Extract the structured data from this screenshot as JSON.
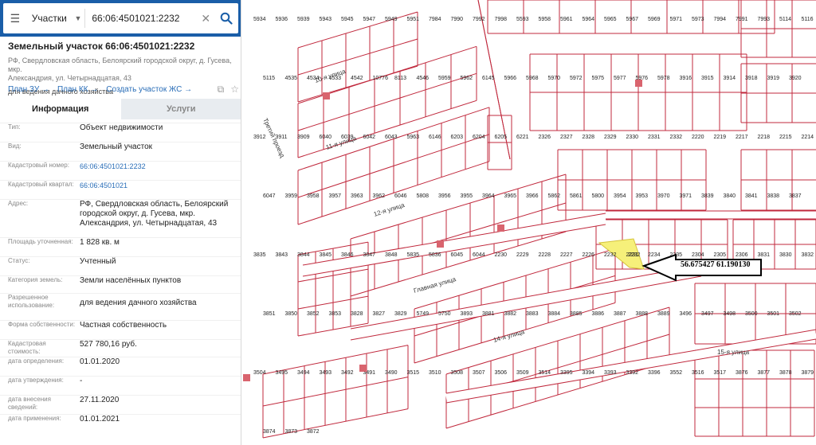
{
  "search": {
    "category": "Участки",
    "query": "66:06:4501021:2232"
  },
  "object": {
    "title": "Земельный участок 66:06:4501021:2232",
    "address_line1": "РФ, Свердловская область, Белоярский городской округ, д. Гусева, мкр.",
    "address_line2": "Александрия, ул. Четырнадцатая, 43",
    "purpose": "для ведения дачного хозяйства"
  },
  "links": [
    "План ЗУ",
    "План КК",
    "Создать участок ЖС"
  ],
  "tabs": [
    "Информация",
    "Услуги"
  ],
  "props": [
    {
      "label": "Тип:",
      "value": "Объект недвижимости"
    },
    {
      "label": "Вид:",
      "value": "Земельный участок"
    },
    {
      "label": "Кадастровый номер:",
      "value": "66:06:4501021:2232"
    },
    {
      "label": "Кадастровый квартал:",
      "value": "66:06:4501021"
    },
    {
      "label": "Адрес:",
      "value_lines": [
        "РФ, Свердловская область, Белоярский",
        "городской округ, д. Гусева, мкр.",
        "Александрия, ул. Четырнадцатая, 43"
      ]
    },
    {
      "label": "Площадь уточненная:",
      "value": "1 828 кв. м"
    },
    {
      "label": "Статус:",
      "value": "Учтенный"
    },
    {
      "label": "Категория земель:",
      "value": "Земли населённых пунктов"
    },
    {
      "label_lines": [
        "Разрешенное",
        "использование:"
      ],
      "value": "для ведения дачного хозяйства"
    },
    {
      "label": "Форма собственности:",
      "value": "Частная собственность"
    },
    {
      "label": "Кадастровая стоимость:",
      "value": "527 780,16 руб."
    },
    {
      "label": "дата определения:",
      "value": "01.01.2020"
    },
    {
      "label": "дата утверждения:",
      "value": "-"
    },
    {
      "label": "дата внесения сведений:",
      "value": "27.11.2020"
    },
    {
      "label": "дата применения:",
      "value": "01.01.2021"
    }
  ],
  "map": {
    "coordinate_label": "56.675427 61.190130",
    "highlight_parcel": "2232",
    "parcels": [
      "5934",
      "5936",
      "5939",
      "5943",
      "5945",
      "5947",
      "5949",
      "5951",
      "7984",
      "7990",
      "7992",
      "7998",
      "5593",
      "5958",
      "5961",
      "5964",
      "5965",
      "5967",
      "5969",
      "5971",
      "5973",
      "7994",
      "7991",
      "7993",
      "5114",
      "5116",
      "5115",
      "4535",
      "4534",
      "4533",
      "4542",
      "10776",
      "8113",
      "4546",
      "5959",
      "5962",
      "6145",
      "5966",
      "5968",
      "5970",
      "5972",
      "5975",
      "5977",
      "5976",
      "5978",
      "3916",
      "3915",
      "3914",
      "3918",
      "3919",
      "3920",
      "3921",
      "3912",
      "3911",
      "3909",
      "6040",
      "6039",
      "6042",
      "6043",
      "5963",
      "6146",
      "6203",
      "6204",
      "6205",
      "6221",
      "2326",
      "2327",
      "2328",
      "2329",
      "2330",
      "2331",
      "2332",
      "2220",
      "2219",
      "2217",
      "2218",
      "2215",
      "2214",
      "6047",
      "3959",
      "3958",
      "3957",
      "3963",
      "3962",
      "6046",
      "5808",
      "3956",
      "3955",
      "3964",
      "3965",
      "3966",
      "5862",
      "5861",
      "5800",
      "3954",
      "3953",
      "3970",
      "3971",
      "3839",
      "3840",
      "3841",
      "3838",
      "3837",
      "3836",
      "3835",
      "3843",
      "3844",
      "3845",
      "3846",
      "3847",
      "3848",
      "5835",
      "5836",
      "6045",
      "6044",
      "2230",
      "2229",
      "2228",
      "2227",
      "2226",
      "2232",
      "2231",
      "2234",
      "2235",
      "2304",
      "2305",
      "2306",
      "3831",
      "3830",
      "3832",
      "3851",
      "3850",
      "3852",
      "3853",
      "3828",
      "3827",
      "3829",
      "5749",
      "5750",
      "3893",
      "3881",
      "3882",
      "3883",
      "3884",
      "3885",
      "3886",
      "3887",
      "3888",
      "3889",
      "3496",
      "3497",
      "3498",
      "3500",
      "3501",
      "3502",
      "3503",
      "3504",
      "3495",
      "3494",
      "3493",
      "3492",
      "3491",
      "3490",
      "3515",
      "3510",
      "3508",
      "3507",
      "3506",
      "3509",
      "3514",
      "3395",
      "3394",
      "3393",
      "3392",
      "3396",
      "3552",
      "3516",
      "3517",
      "3876",
      "3877",
      "3878",
      "3879",
      "3874",
      "3873",
      "3872"
    ],
    "streets": [
      "10-я улица",
      "11-я улица",
      "12-я улица",
      "Третий проезд",
      "Главная улица",
      "14-я улица",
      "15-я улица"
    ]
  }
}
